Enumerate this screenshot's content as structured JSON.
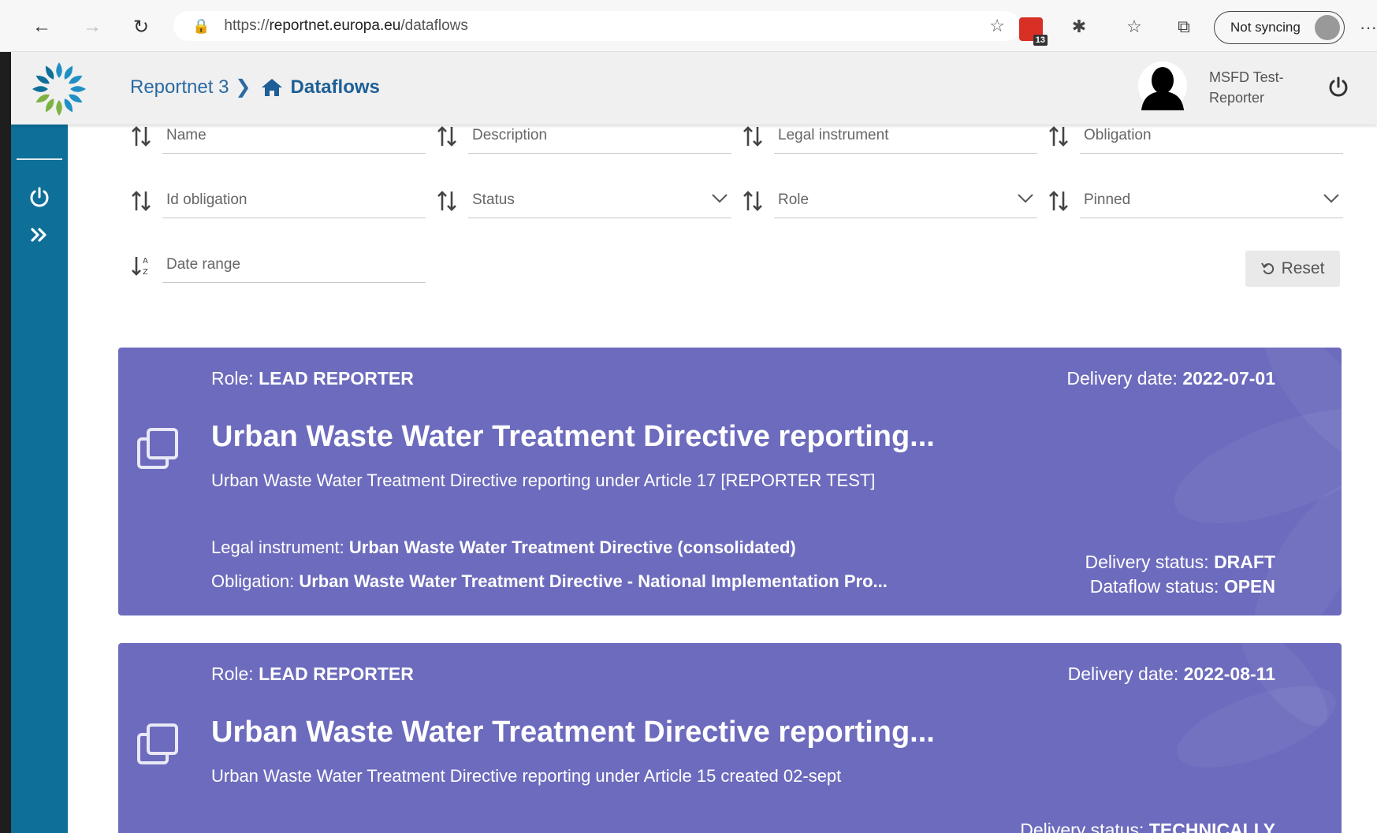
{
  "browser": {
    "url_prefix": "https://",
    "url_host": "reportnet.europa.eu",
    "url_path": "/dataflows",
    "extension_badge": "13",
    "sync_label": "Not syncing",
    "more_label": "···"
  },
  "header": {
    "breadcrumb_root": "Reportnet 3",
    "breadcrumb_current": "Dataflows",
    "user_name_line1": "MSFD Test-",
    "user_name_line2": "Reporter"
  },
  "filters": {
    "name": "Name",
    "description": "Description",
    "legal_instrument": "Legal instrument",
    "obligation": "Obligation",
    "id_obligation": "Id obligation",
    "status": "Status",
    "role": "Role",
    "pinned": "Pinned",
    "date_range": "Date range",
    "reset_label": "Reset"
  },
  "labels": {
    "role": "Role:",
    "delivery_date": "Delivery date:",
    "legal_instrument": "Legal instrument:",
    "obligation": "Obligation:",
    "delivery_status": "Delivery status:",
    "dataflow_status": "Dataflow status:"
  },
  "cards": [
    {
      "role": "LEAD REPORTER",
      "delivery_date": "2022-07-01",
      "title": "Urban Waste Water Treatment Directive reporting...",
      "description": "Urban Waste Water Treatment Directive reporting under Article 17 [REPORTER TEST]",
      "legal_instrument": "Urban Waste Water Treatment Directive (consolidated)",
      "obligation": "Urban Waste Water Treatment Directive - National Implementation Pro...",
      "delivery_status": "DRAFT",
      "dataflow_status": "OPEN"
    },
    {
      "role": "LEAD REPORTER",
      "delivery_date": "2022-08-11",
      "title": "Urban Waste Water Treatment Directive reporting...",
      "description": "Urban Waste Water Treatment Directive reporting under Article 15 created 02-sept",
      "delivery_status": "TECHNICALLY"
    }
  ],
  "colors": {
    "card_bg": "#6c6bbd",
    "sidebar_bg": "#0e6f99",
    "accent_blue": "#1d5f96"
  }
}
